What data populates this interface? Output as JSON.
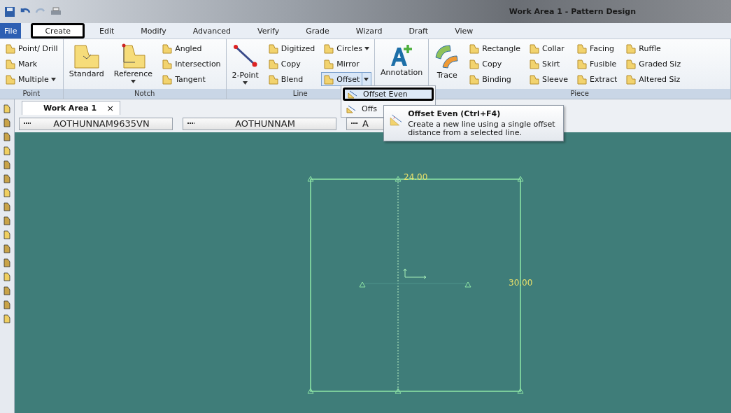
{
  "title_bar": {
    "title": "Work Area 1 - Pattern Design"
  },
  "menu": [
    {
      "label": "File",
      "kind": "file",
      "selected": false
    },
    {
      "label": "Create",
      "kind": "tab",
      "selected": true
    },
    {
      "label": "Edit",
      "kind": "tab",
      "selected": false
    },
    {
      "label": "Modify",
      "kind": "tab",
      "selected": false
    },
    {
      "label": "Advanced",
      "kind": "tab",
      "selected": false
    },
    {
      "label": "Verify",
      "kind": "tab",
      "selected": false
    },
    {
      "label": "Grade",
      "kind": "tab",
      "selected": false
    },
    {
      "label": "Wizard",
      "kind": "tab",
      "selected": false
    },
    {
      "label": "Draft",
      "kind": "tab",
      "selected": false
    },
    {
      "label": "View",
      "kind": "tab",
      "selected": false
    }
  ],
  "ribbon": {
    "groups": [
      {
        "label": "Point",
        "columns": [
          [
            {
              "label": "Point/ Drill",
              "kind": "small",
              "dropdown": false,
              "active": false
            },
            {
              "label": "Mark",
              "kind": "small",
              "dropdown": false,
              "active": false
            },
            {
              "label": "Multiple",
              "kind": "small",
              "dropdown": true,
              "active": false
            }
          ]
        ]
      },
      {
        "label": "Notch",
        "columns": [
          [
            {
              "label": "Standard",
              "kind": "shape",
              "dropdown": false,
              "active": false
            }
          ],
          [
            {
              "label": "Reference",
              "kind": "corner",
              "dropdown": true,
              "active": false
            }
          ],
          [
            {
              "label": "Angled",
              "kind": "small",
              "dropdown": false,
              "active": false
            },
            {
              "label": "Intersection",
              "kind": "small",
              "dropdown": false,
              "active": false
            },
            {
              "label": "Tangent",
              "kind": "small",
              "dropdown": false,
              "active": false
            }
          ]
        ]
      },
      {
        "label": "Line",
        "columns": [
          [
            {
              "label": "2-Point",
              "kind": "line",
              "dropdown": true,
              "active": false
            }
          ],
          [
            {
              "label": "Digitized",
              "kind": "small",
              "dropdown": false,
              "active": false
            },
            {
              "label": "Copy",
              "kind": "small",
              "dropdown": false,
              "active": false
            },
            {
              "label": "Blend",
              "kind": "small",
              "dropdown": false,
              "active": false
            }
          ],
          [
            {
              "label": "Circles",
              "kind": "small",
              "dropdown": true,
              "active": false
            },
            {
              "label": "Mirror",
              "kind": "small",
              "dropdown": false,
              "active": false
            },
            {
              "label": "Offset",
              "kind": "small",
              "dropdown": true,
              "active": true
            }
          ]
        ]
      },
      {
        "columns": [
          [
            {
              "label": "Annotation",
              "kind": "text",
              "dropdown": false,
              "active": false
            }
          ]
        ]
      },
      {
        "label": "Piece",
        "columns": [
          [
            {
              "label": "Trace",
              "kind": "trace",
              "dropdown": false,
              "active": false
            }
          ],
          [
            {
              "label": "Rectangle",
              "kind": "small",
              "dropdown": false,
              "active": false
            },
            {
              "label": "Copy",
              "kind": "small",
              "dropdown": false,
              "active": false
            },
            {
              "label": "Binding",
              "kind": "small",
              "dropdown": false,
              "active": false
            }
          ],
          [
            {
              "label": "Collar",
              "kind": "small",
              "dropdown": false,
              "active": false
            },
            {
              "label": "Skirt",
              "kind": "small",
              "dropdown": false,
              "active": false
            },
            {
              "label": "Sleeve",
              "kind": "small",
              "dropdown": false,
              "active": false
            }
          ],
          [
            {
              "label": "Facing",
              "kind": "small",
              "dropdown": false,
              "active": false
            },
            {
              "label": "Fusible",
              "kind": "small",
              "dropdown": false,
              "active": false
            },
            {
              "label": "Extract",
              "kind": "small",
              "dropdown": false,
              "active": false
            }
          ],
          [
            {
              "label": "Ruffle",
              "kind": "small",
              "dropdown": false,
              "active": false
            },
            {
              "label": "Graded Siz",
              "kind": "small",
              "dropdown": false,
              "active": false
            },
            {
              "label": "Altered Siz",
              "kind": "small",
              "dropdown": false,
              "active": false
            }
          ]
        ]
      }
    ]
  },
  "dropdown_menu": {
    "items": [
      {
        "label": "Offset Even",
        "selected": true
      },
      {
        "label": "Offs",
        "selected": false
      }
    ]
  },
  "tooltip": {
    "title": "Offset Even (Ctrl+F4)",
    "description": "Create a new line using a single offset distance from a selected line."
  },
  "tabs": [
    {
      "label": "Work Area 1",
      "close": "×",
      "selected": true
    }
  ],
  "fields": [
    {
      "value": "AOTHUNNAM9635VN"
    },
    {
      "value": "AOTHUNNAM"
    },
    {
      "value": "A"
    }
  ],
  "piece": {
    "width_label": "24.00",
    "length_label": "30.00"
  }
}
